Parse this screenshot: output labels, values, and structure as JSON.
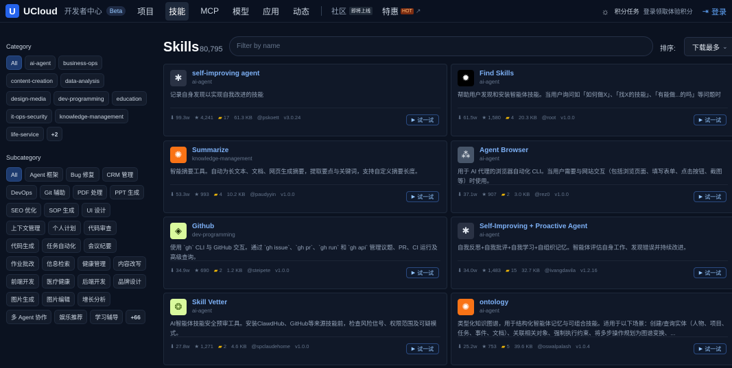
{
  "nav": {
    "logo_letter": "U",
    "brand": "UCloud",
    "dev_center": "开发者中心",
    "beta": "Beta",
    "items": [
      "项目",
      "技能",
      "MCP",
      "模型",
      "应用",
      "动态"
    ],
    "community": "社区",
    "community_badge": "即将上线",
    "promo": "特惠",
    "promo_badge": "HOT",
    "points": "积分任务",
    "login_hint": "登录领取体验积分",
    "login": "登录"
  },
  "sidebar": {
    "category_title": "Category",
    "categories": [
      "All",
      "ai-agent",
      "business-ops",
      "content-creation",
      "data-analysis",
      "design-media",
      "dev-programming",
      "education",
      "it-ops-security",
      "knowledge-management",
      "life-service",
      "+2"
    ],
    "subcategory_title": "Subcategory",
    "subcategories": [
      "All",
      "Agent 框架",
      "Bug 修复",
      "CRM 管理",
      "DevOps",
      "Git 辅助",
      "PDF 处理",
      "PPT 生成",
      "SEO 优化",
      "SOP 生成",
      "UI 设计",
      "上下文管理",
      "个人计划",
      "代码审查",
      "代码生成",
      "任务自动化",
      "会议纪要",
      "作业批改",
      "信息检索",
      "健康管理",
      "内容改写",
      "前端开发",
      "医疗健康",
      "后端开发",
      "品牌设计",
      "图片生成",
      "图片编辑",
      "增长分析",
      "多 Agent 协作",
      "娱乐推荐",
      "学习辅导",
      "+66"
    ]
  },
  "header": {
    "title": "Skills",
    "count": "80,795",
    "filter_placeholder": "Filter by name",
    "sort_label": "排序:",
    "sort_value": "下载最多"
  },
  "try_label": "试一试",
  "cards": [
    {
      "title": "self-improving agent",
      "category": "ai-agent",
      "desc": "记录自身发现以实现自我改进的技能",
      "downloads": "99.3w",
      "stars": "4,241",
      "files": "17",
      "size": "61.3 KB",
      "author": "@pskoett",
      "version": "v3.0.24",
      "icon": "gear-icon",
      "icon_bg": "#2a3244",
      "icon_color": "#e2e8f0",
      "glyph": "✱"
    },
    {
      "title": "Find Skills",
      "category": "ai-agent",
      "desc": "帮助用户发现和安装智能体技能。当用户询问如「如何做X」、「找X的技能」、「有能做...的吗」等问题时",
      "downloads": "61.5w",
      "stars": "1,580",
      "files": "4",
      "size": "20.3 KB",
      "author": "@root",
      "version": "v1.0.0",
      "icon": "sparkle-icon",
      "icon_bg": "#000000",
      "icon_color": "#ffffff",
      "glyph": "✹"
    },
    {
      "title": "Summarize",
      "category": "knowledge-management",
      "desc": "智能摘要工具。自动为长文本、文档、网页生成摘要，提取要点与关键词，支持自定义摘要长度。",
      "downloads": "53.3w",
      "stars": "993",
      "files": "4",
      "size": "10.2 KB",
      "author": "@paudyyin",
      "version": "v1.0.0",
      "icon": "sun-icon",
      "icon_bg": "#f97316",
      "icon_color": "#ffffff",
      "glyph": "✺"
    },
    {
      "title": "Agent Browser",
      "category": "ai-agent",
      "desc": "用于 AI 代理的浏览器自动化 CLI。当用户需要与网站交互（包括浏览页面、填写表单、点击按钮、截图等）时使用。",
      "downloads": "37.1w",
      "stars": "907",
      "files": "2",
      "size": "3.0 KB",
      "author": "@rez0",
      "version": "v1.0.0",
      "icon": "grid-icon",
      "icon_bg": "#475569",
      "icon_color": "#f1f5f9",
      "glyph": "⁂"
    },
    {
      "title": "Github",
      "category": "dev-programming",
      "desc": "使用 `gh` CLI 与 GitHub 交互。通过 `gh issue`、`gh pr`、`gh run` 和 `gh api` 管理议题、PR、CI 运行及高级查询。",
      "downloads": "34.9w",
      "stars": "690",
      "files": "2",
      "size": "1.2 KB",
      "author": "@steipete",
      "version": "v1.0.0",
      "icon": "diamond-icon",
      "icon_bg": "#d9f99d",
      "icon_color": "#1a2e05",
      "glyph": "◈"
    },
    {
      "title": "Self-Improving + Proactive Agent",
      "category": "ai-agent",
      "desc": "自我反思+自我批评+自我学习+自组织记忆。智能体评估自身工作、发现错误并持续改进。",
      "downloads": "34.0w",
      "stars": "1,483",
      "files": "15",
      "size": "32.7 KB",
      "author": "@ivangdavila",
      "version": "v1.2.16",
      "icon": "gear-icon",
      "icon_bg": "#2a3244",
      "icon_color": "#e2e8f0",
      "glyph": "✱"
    },
    {
      "title": "Skill Vetter",
      "category": "ai-agent",
      "desc": "AI智能体技能安全预审工具。安装ClawdHub、GitHub等来源技能前，检查风险信号、权限范围及可疑模式。",
      "downloads": "27.8w",
      "stars": "1,271",
      "files": "2",
      "size": "4.6 KB",
      "author": "@spclaudehome",
      "version": "v1.0.0",
      "icon": "shield-icon",
      "icon_bg": "#d9f99d",
      "icon_color": "#3f6212",
      "glyph": "❂"
    },
    {
      "title": "ontology",
      "category": "ai-agent",
      "desc": "类型化知识图谱，用于结构化智能体记忆与可组合技能。适用于以下场景：创建/查询实体（人物、项目、任务、事件、文档）、关联相关对象、强制执行约束、将多步操作规划为图谱变换、...",
      "downloads": "25.2w",
      "stars": "753",
      "files": "5",
      "size": "39.6 KB",
      "author": "@oswalpalash",
      "version": "v1.0.4",
      "icon": "sun-icon",
      "icon_bg": "#f97316",
      "icon_color": "#ffffff",
      "glyph": "✺"
    }
  ]
}
